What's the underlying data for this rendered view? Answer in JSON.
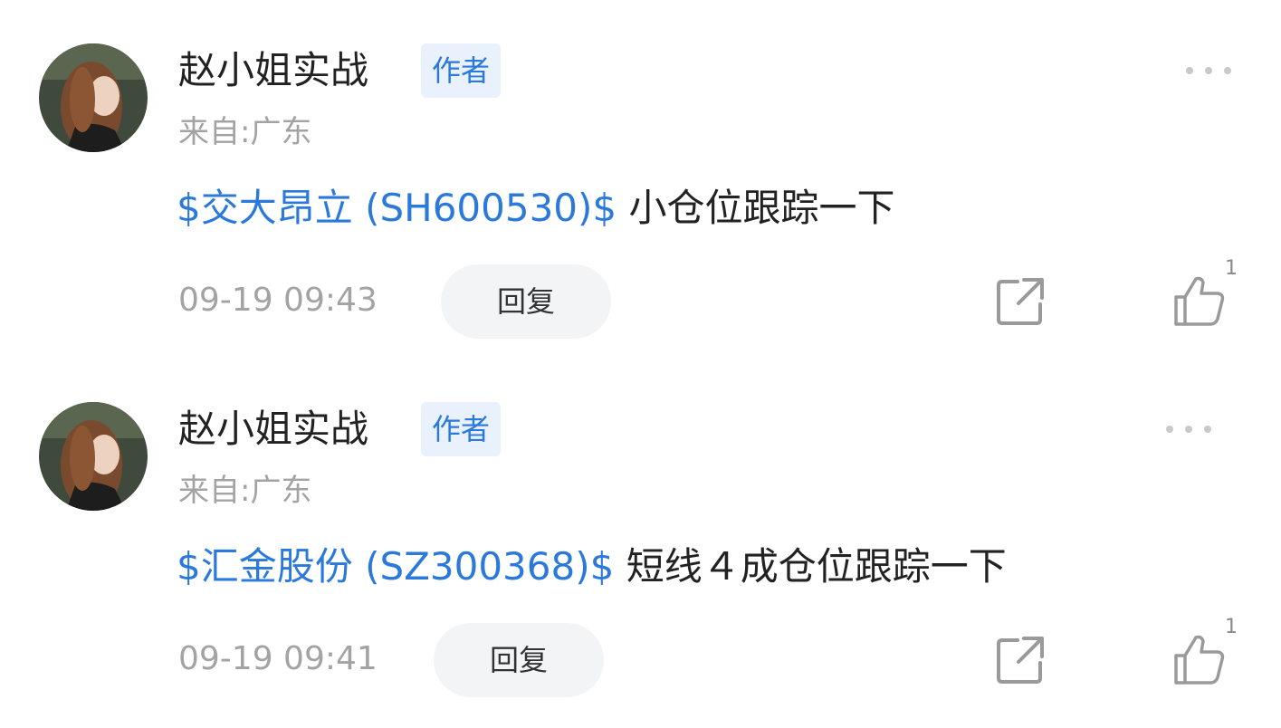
{
  "colors": {
    "accent": "#2a79db",
    "badge_bg": "#e8f1fc",
    "text_primary": "#222222",
    "text_secondary": "#a3a3a3",
    "reply_bg": "#f3f4f6"
  },
  "icons": {
    "more": "more-dots-icon",
    "share": "share-icon",
    "like": "thumbs-up-icon"
  },
  "posts": [
    {
      "author": "赵小姐实战",
      "badge": "作者",
      "location": "来自:广东",
      "stock_tag": "$交大昂立 (SH600530)$",
      "text": " 小仓位跟踪一下",
      "time": "09-19 09:43",
      "reply_label": "回复",
      "like_count": "1"
    },
    {
      "author": "赵小姐实战",
      "badge": "作者",
      "location": "来自:广东",
      "stock_tag": "$汇金股份 (SZ300368)$",
      "text": " 短线４成仓位跟踪一下",
      "time": "09-19 09:41",
      "reply_label": "回复",
      "like_count": "1"
    }
  ]
}
